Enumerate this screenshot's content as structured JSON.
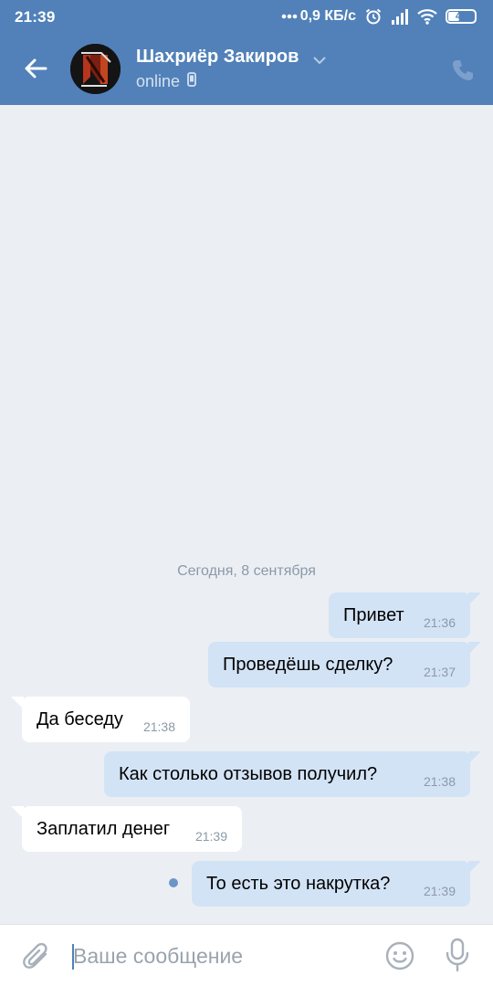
{
  "status_bar": {
    "time": "21:39",
    "network_speed": "0,9 КБ/с",
    "battery_level": "41",
    "battery_fraction": 0.41,
    "icons": [
      "dots-icon",
      "alarm-icon",
      "signal-icon",
      "wifi-icon",
      "battery-icon"
    ]
  },
  "header": {
    "back_icon": "arrow-left-icon",
    "peer_name": "Шахриёр Закиров",
    "peer_status": "online",
    "status_icon": "mobile-icon",
    "call_icon": "phone-icon"
  },
  "conversation": {
    "date_separator": "Сегодня, 8 сентября",
    "messages": [
      {
        "direction": "out",
        "text": "Привет",
        "time": "21:36"
      },
      {
        "direction": "out",
        "text": "Проведёшь сделку?",
        "time": "21:37"
      },
      {
        "direction": "in",
        "text": "Да беседу",
        "time": "21:38"
      },
      {
        "direction": "out",
        "text": "Как столько отзывов получил?",
        "time": "21:38"
      },
      {
        "direction": "in",
        "text": "Заплатил денег",
        "time": "21:39"
      },
      {
        "direction": "out",
        "text": "То есть это накрутка?",
        "time": "21:39",
        "unread": true
      }
    ]
  },
  "composer": {
    "placeholder": "Ваше сообщение",
    "value": "",
    "icons": [
      "paperclip-icon",
      "emoji-icon",
      "microphone-icon"
    ]
  },
  "colors": {
    "header_bg": "#5181b8",
    "chat_bg": "#ebeff4",
    "outgoing_bubble": "#d3e3f6",
    "incoming_bubble": "#ffffff",
    "timestamp": "#8c99a8"
  }
}
